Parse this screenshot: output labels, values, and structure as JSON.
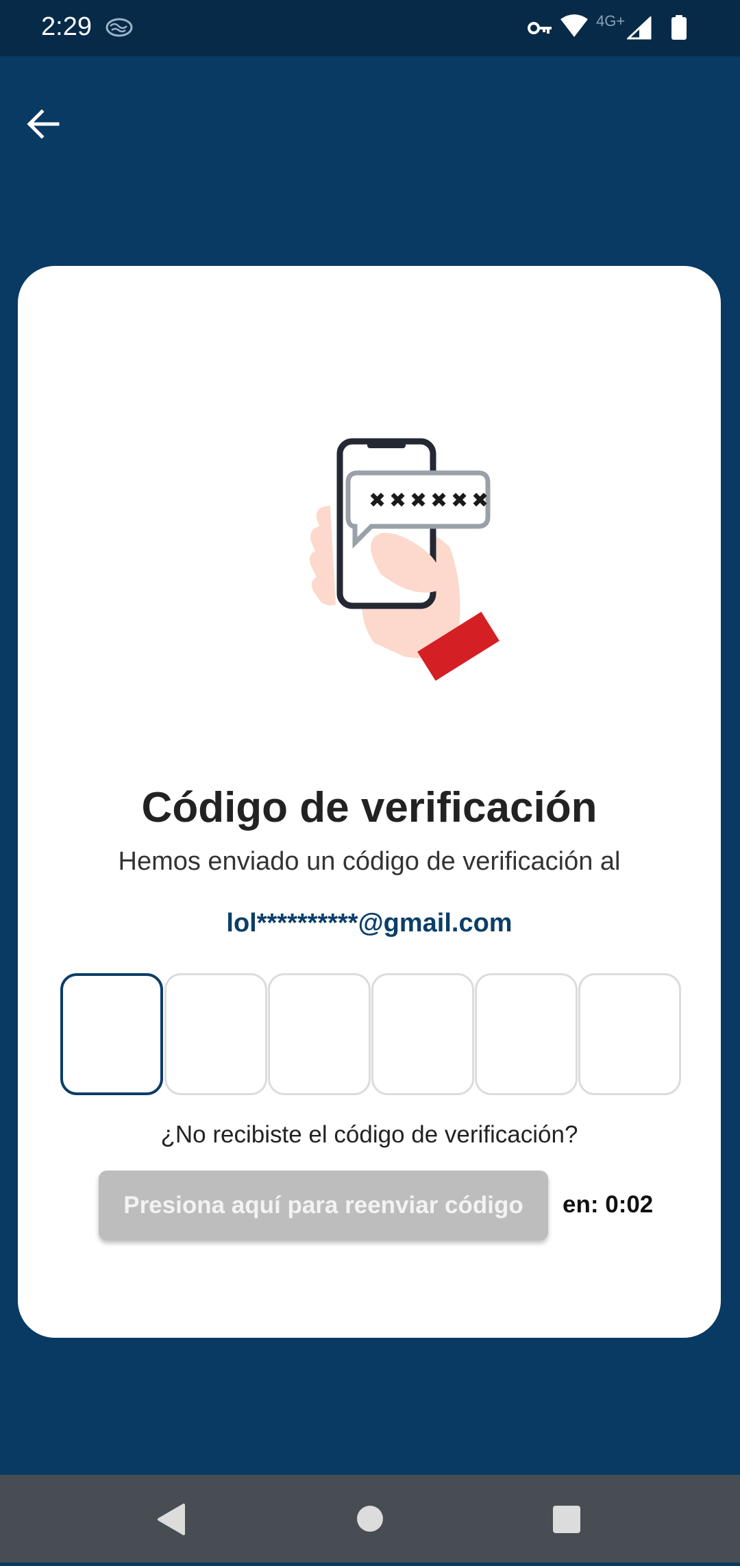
{
  "status_bar": {
    "time": "2:29",
    "network_label": "4G+",
    "icons": [
      "brain-icon",
      "vpn-key-icon",
      "wifi-icon",
      "cell-signal-icon",
      "battery-icon"
    ]
  },
  "header": {
    "back_icon": "arrow-left-icon"
  },
  "card": {
    "illustration": "phone-in-hand-with-code-bubble",
    "title": "Código de verificación",
    "subtitle": "Hemos enviado un código de verificación al",
    "email": "lol**********@gmail.com",
    "otp_digits": [
      "",
      "",
      "",
      "",
      "",
      ""
    ],
    "otp_active_index": 0,
    "resend_question": "¿No recibiste el código de verificación?",
    "resend_button": "Presiona aquí para reenviar código",
    "countdown": "en: 0:02"
  },
  "nav_bar": {
    "items": [
      "back-triangle-icon",
      "home-circle-icon",
      "recents-square-icon"
    ]
  },
  "colors": {
    "background": "#083a63",
    "status_bar": "#062a48",
    "accent": "#0b3e69",
    "card": "#ffffff",
    "disabled_button": "#bdbdbd",
    "nav_bar": "#474d52",
    "cuff_red": "#d42024",
    "skin": "#fcd9cc"
  }
}
